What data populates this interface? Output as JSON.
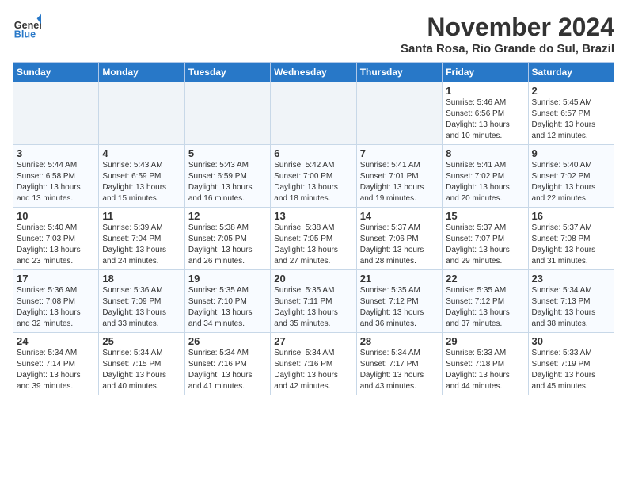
{
  "header": {
    "logo_line1": "General",
    "logo_line2": "Blue",
    "title": "November 2024",
    "subtitle": "Santa Rosa, Rio Grande do Sul, Brazil"
  },
  "weekdays": [
    "Sunday",
    "Monday",
    "Tuesday",
    "Wednesday",
    "Thursday",
    "Friday",
    "Saturday"
  ],
  "weeks": [
    [
      {
        "day": "",
        "info": ""
      },
      {
        "day": "",
        "info": ""
      },
      {
        "day": "",
        "info": ""
      },
      {
        "day": "",
        "info": ""
      },
      {
        "day": "",
        "info": ""
      },
      {
        "day": "1",
        "info": "Sunrise: 5:46 AM\nSunset: 6:56 PM\nDaylight: 13 hours\nand 10 minutes."
      },
      {
        "day": "2",
        "info": "Sunrise: 5:45 AM\nSunset: 6:57 PM\nDaylight: 13 hours\nand 12 minutes."
      }
    ],
    [
      {
        "day": "3",
        "info": "Sunrise: 5:44 AM\nSunset: 6:58 PM\nDaylight: 13 hours\nand 13 minutes."
      },
      {
        "day": "4",
        "info": "Sunrise: 5:43 AM\nSunset: 6:59 PM\nDaylight: 13 hours\nand 15 minutes."
      },
      {
        "day": "5",
        "info": "Sunrise: 5:43 AM\nSunset: 6:59 PM\nDaylight: 13 hours\nand 16 minutes."
      },
      {
        "day": "6",
        "info": "Sunrise: 5:42 AM\nSunset: 7:00 PM\nDaylight: 13 hours\nand 18 minutes."
      },
      {
        "day": "7",
        "info": "Sunrise: 5:41 AM\nSunset: 7:01 PM\nDaylight: 13 hours\nand 19 minutes."
      },
      {
        "day": "8",
        "info": "Sunrise: 5:41 AM\nSunset: 7:02 PM\nDaylight: 13 hours\nand 20 minutes."
      },
      {
        "day": "9",
        "info": "Sunrise: 5:40 AM\nSunset: 7:02 PM\nDaylight: 13 hours\nand 22 minutes."
      }
    ],
    [
      {
        "day": "10",
        "info": "Sunrise: 5:40 AM\nSunset: 7:03 PM\nDaylight: 13 hours\nand 23 minutes."
      },
      {
        "day": "11",
        "info": "Sunrise: 5:39 AM\nSunset: 7:04 PM\nDaylight: 13 hours\nand 24 minutes."
      },
      {
        "day": "12",
        "info": "Sunrise: 5:38 AM\nSunset: 7:05 PM\nDaylight: 13 hours\nand 26 minutes."
      },
      {
        "day": "13",
        "info": "Sunrise: 5:38 AM\nSunset: 7:05 PM\nDaylight: 13 hours\nand 27 minutes."
      },
      {
        "day": "14",
        "info": "Sunrise: 5:37 AM\nSunset: 7:06 PM\nDaylight: 13 hours\nand 28 minutes."
      },
      {
        "day": "15",
        "info": "Sunrise: 5:37 AM\nSunset: 7:07 PM\nDaylight: 13 hours\nand 29 minutes."
      },
      {
        "day": "16",
        "info": "Sunrise: 5:37 AM\nSunset: 7:08 PM\nDaylight: 13 hours\nand 31 minutes."
      }
    ],
    [
      {
        "day": "17",
        "info": "Sunrise: 5:36 AM\nSunset: 7:08 PM\nDaylight: 13 hours\nand 32 minutes."
      },
      {
        "day": "18",
        "info": "Sunrise: 5:36 AM\nSunset: 7:09 PM\nDaylight: 13 hours\nand 33 minutes."
      },
      {
        "day": "19",
        "info": "Sunrise: 5:35 AM\nSunset: 7:10 PM\nDaylight: 13 hours\nand 34 minutes."
      },
      {
        "day": "20",
        "info": "Sunrise: 5:35 AM\nSunset: 7:11 PM\nDaylight: 13 hours\nand 35 minutes."
      },
      {
        "day": "21",
        "info": "Sunrise: 5:35 AM\nSunset: 7:12 PM\nDaylight: 13 hours\nand 36 minutes."
      },
      {
        "day": "22",
        "info": "Sunrise: 5:35 AM\nSunset: 7:12 PM\nDaylight: 13 hours\nand 37 minutes."
      },
      {
        "day": "23",
        "info": "Sunrise: 5:34 AM\nSunset: 7:13 PM\nDaylight: 13 hours\nand 38 minutes."
      }
    ],
    [
      {
        "day": "24",
        "info": "Sunrise: 5:34 AM\nSunset: 7:14 PM\nDaylight: 13 hours\nand 39 minutes."
      },
      {
        "day": "25",
        "info": "Sunrise: 5:34 AM\nSunset: 7:15 PM\nDaylight: 13 hours\nand 40 minutes."
      },
      {
        "day": "26",
        "info": "Sunrise: 5:34 AM\nSunset: 7:16 PM\nDaylight: 13 hours\nand 41 minutes."
      },
      {
        "day": "27",
        "info": "Sunrise: 5:34 AM\nSunset: 7:16 PM\nDaylight: 13 hours\nand 42 minutes."
      },
      {
        "day": "28",
        "info": "Sunrise: 5:34 AM\nSunset: 7:17 PM\nDaylight: 13 hours\nand 43 minutes."
      },
      {
        "day": "29",
        "info": "Sunrise: 5:33 AM\nSunset: 7:18 PM\nDaylight: 13 hours\nand 44 minutes."
      },
      {
        "day": "30",
        "info": "Sunrise: 5:33 AM\nSunset: 7:19 PM\nDaylight: 13 hours\nand 45 minutes."
      }
    ]
  ],
  "accent_color": "#2878c8"
}
